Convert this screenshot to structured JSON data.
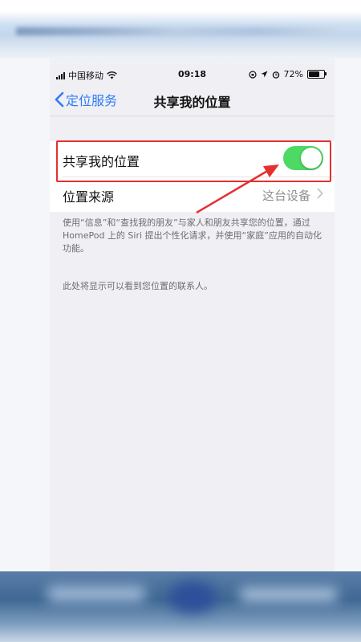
{
  "status_bar": {
    "carrier": "中国移动",
    "time": "09:18",
    "battery": "72%"
  },
  "nav": {
    "back_label": "定位服务",
    "title": "共享我的位置"
  },
  "settings": {
    "share_location_label": "共享我的位置",
    "share_location_on": true,
    "location_source_label": "位置来源",
    "location_source_value": "这台设备"
  },
  "footer": {
    "description": "使用“信息”和“查找我的朋友”与家人和朋友共享您的位置，通过 HomePod 上的 Siri 提出个性化请求，并使用“家庭”应用的自动化功能。",
    "contacts_note": "此处将显示可以看到您位置的联系人。"
  },
  "colors": {
    "accent": "#2f7cf6",
    "toggle_on": "#4cd964",
    "annotation": "#e53030"
  },
  "icons": [
    "signal-icon",
    "wifi-icon",
    "location-arrow-icon",
    "alarm-icon",
    "battery-icon",
    "back-chevron-icon",
    "chevron-right-icon"
  ]
}
